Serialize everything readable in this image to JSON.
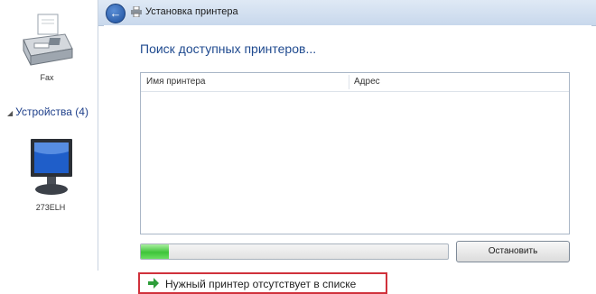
{
  "background": {
    "fax": {
      "label": "Fax"
    },
    "devices_group": {
      "label": "Устройства (4)"
    },
    "monitor": {
      "label": "273ELH"
    }
  },
  "dialog": {
    "title": "Установка принтера",
    "search_heading": "Поиск доступных принтеров...",
    "columns": [
      "Имя принтера",
      "Адрес"
    ],
    "progress": 0.09,
    "stop_button": "Остановить",
    "missing_printer_link": "Нужный принтер отсутствует в списке"
  },
  "colors": {
    "link_blue": "#1f4a8f",
    "highlight_red": "#d0313b",
    "progress_green": "#3fc43a"
  }
}
